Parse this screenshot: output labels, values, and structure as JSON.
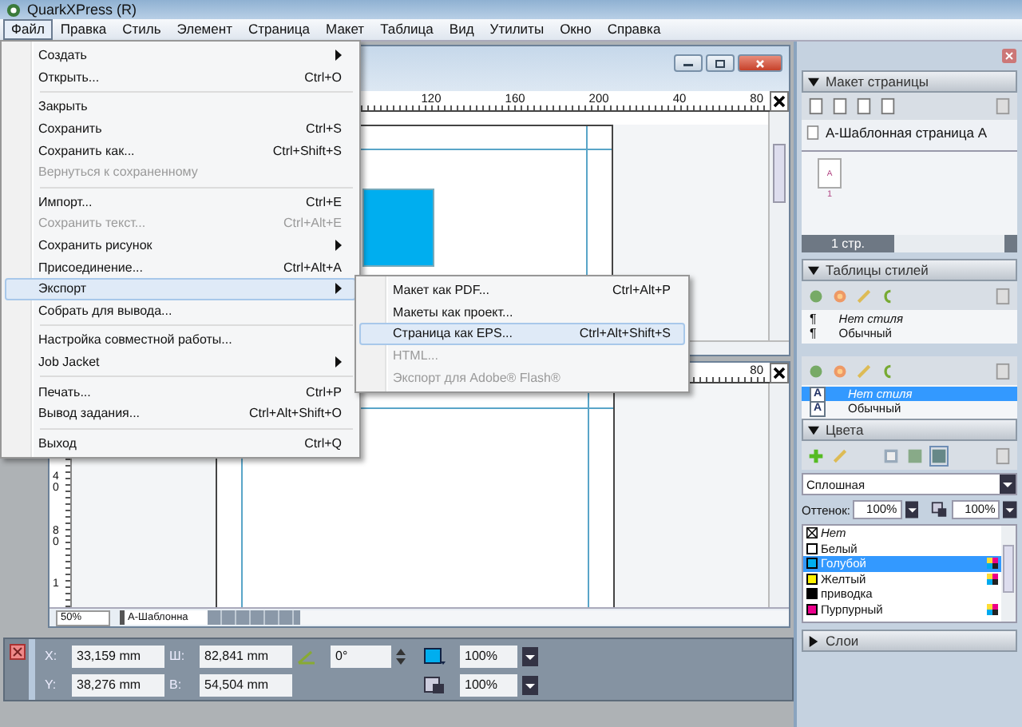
{
  "window": {
    "title": "QuarkXPress (R)"
  },
  "menubar": [
    {
      "label": "Файл",
      "selected": true
    },
    {
      "label": "Правка",
      "selected": false
    },
    {
      "label": "Стиль",
      "selected": false
    },
    {
      "label": "Элемент",
      "selected": false
    },
    {
      "label": "Страница",
      "selected": false
    },
    {
      "label": "Макет",
      "selected": false
    },
    {
      "label": "Таблица",
      "selected": false
    },
    {
      "label": "Вид",
      "selected": false
    },
    {
      "label": "Утилиты",
      "selected": false
    },
    {
      "label": "Окно",
      "selected": false
    },
    {
      "label": "Справка",
      "selected": false
    }
  ],
  "file_menu": [
    [
      {
        "label": "Создать",
        "submenu": true,
        "disabled": false,
        "selected": false
      },
      {
        "label": "Открыть...",
        "shortcut": "Ctrl+O",
        "submenu": false,
        "disabled": false,
        "selected": false
      }
    ],
    [
      {
        "label": "Закрыть",
        "submenu": false,
        "disabled": false,
        "selected": false
      },
      {
        "label": "Сохранить",
        "shortcut": "Ctrl+S",
        "submenu": false,
        "disabled": false,
        "selected": false
      },
      {
        "label": "Сохранить как...",
        "shortcut": "Ctrl+Shift+S",
        "submenu": false,
        "disabled": false,
        "selected": false
      },
      {
        "label": "Вернуться к сохраненному",
        "submenu": false,
        "disabled": true,
        "selected": false
      }
    ],
    [
      {
        "label": "Импорт...",
        "shortcut": "Ctrl+E",
        "submenu": false,
        "disabled": false,
        "selected": false
      },
      {
        "label": "Сохранить текст...",
        "shortcut": "Ctrl+Alt+E",
        "submenu": false,
        "disabled": true,
        "selected": false
      },
      {
        "label": "Сохранить рисунок",
        "submenu": true,
        "disabled": false,
        "selected": false
      },
      {
        "label": "Присоединение...",
        "shortcut": "Ctrl+Alt+A",
        "submenu": false,
        "disabled": false,
        "selected": false
      },
      {
        "label": "Экспорт",
        "submenu": true,
        "disabled": false,
        "selected": true
      },
      {
        "label": "Собрать для вывода...",
        "submenu": false,
        "disabled": false,
        "selected": false
      }
    ],
    [
      {
        "label": "Настройка совместной работы...",
        "submenu": false,
        "disabled": false,
        "selected": false
      },
      {
        "label": "Job Jacket",
        "submenu": true,
        "disabled": false,
        "selected": false
      }
    ],
    [
      {
        "label": "Печать...",
        "shortcut": "Ctrl+P",
        "submenu": false,
        "disabled": false,
        "selected": false
      },
      {
        "label": "Вывод задания...",
        "shortcut": "Ctrl+Alt+Shift+O",
        "submenu": false,
        "disabled": false,
        "selected": false
      }
    ],
    [
      {
        "label": "Выход",
        "shortcut": "Ctrl+Q",
        "submenu": false,
        "disabled": false,
        "selected": false
      }
    ]
  ],
  "export_submenu": [
    {
      "label": "Макет как PDF...",
      "shortcut": "Ctrl+Alt+P",
      "disabled": false,
      "selected": false
    },
    {
      "label": "Макеты как проект...",
      "disabled": false,
      "selected": false
    },
    {
      "label": "Страница как EPS...",
      "shortcut": "Ctrl+Alt+Shift+S",
      "disabled": false,
      "selected": true
    },
    {
      "label": "HTML...",
      "disabled": true,
      "selected": false
    },
    {
      "label": "Экспорт для Adobe® Flash®",
      "disabled": true,
      "selected": false
    }
  ],
  "documents": [
    {
      "ruler_labels": [
        "120",
        "160",
        "200",
        "40",
        "80"
      ]
    },
    {
      "ruler_labels": [
        "80"
      ],
      "vertical_ruler_labels": [
        "40",
        "80",
        "1"
      ],
      "zoom": "50%",
      "page_field": "А-Шаблонна"
    }
  ],
  "palettes": {
    "page_layout": {
      "title": "Макет страницы",
      "master": "А-Шаблонная страница А",
      "thumb_label": "А",
      "page_number": "1",
      "page_count": "1 стр."
    },
    "style_sheets": {
      "title": "Таблицы стилей",
      "paragraph_styles": [
        {
          "marker": "¶",
          "name": "Нет стиля",
          "kind": "none"
        },
        {
          "marker": "¶",
          "name": "Обычный",
          "kind": "style"
        }
      ],
      "character_styles": [
        {
          "marker": "A",
          "name": "Нет стиля",
          "kind": "none",
          "selected": true
        },
        {
          "marker": "A",
          "name": "Обычный",
          "kind": "style",
          "selected": false
        }
      ]
    },
    "colors": {
      "title": "Цвета",
      "fill_type": "Сплошная",
      "shade_label": "Оттенок:",
      "shade": "100%",
      "opacity": "100%",
      "items": [
        {
          "name": "Нет",
          "kind": "none",
          "selected": false,
          "process": false
        },
        {
          "name": "Белый",
          "kind": "swatch",
          "color": "#ffffff",
          "selected": false,
          "process": false
        },
        {
          "name": "Голубой",
          "kind": "swatch",
          "color": "#00aeef",
          "selected": true,
          "process": true
        },
        {
          "name": "Желтый",
          "kind": "swatch",
          "color": "#fff200",
          "selected": false,
          "process": true
        },
        {
          "name": "приводка",
          "kind": "swatch",
          "color": "#000000",
          "selected": false,
          "process": false
        },
        {
          "name": "Пурпурный",
          "kind": "swatch",
          "color": "#ec008c",
          "selected": false,
          "process": true
        }
      ]
    },
    "layers": {
      "title": "Слои",
      "expanded": false
    }
  },
  "measurements": {
    "x_label": "X:",
    "x": "33,159 mm",
    "y_label": "Y:",
    "y": "38,276 mm",
    "w_label": "Ш:",
    "w": "82,841 mm",
    "h_label": "В:",
    "h": "54,504 mm",
    "angle": "0°",
    "fill_opacity": "100%",
    "frame_opacity": "100%"
  }
}
